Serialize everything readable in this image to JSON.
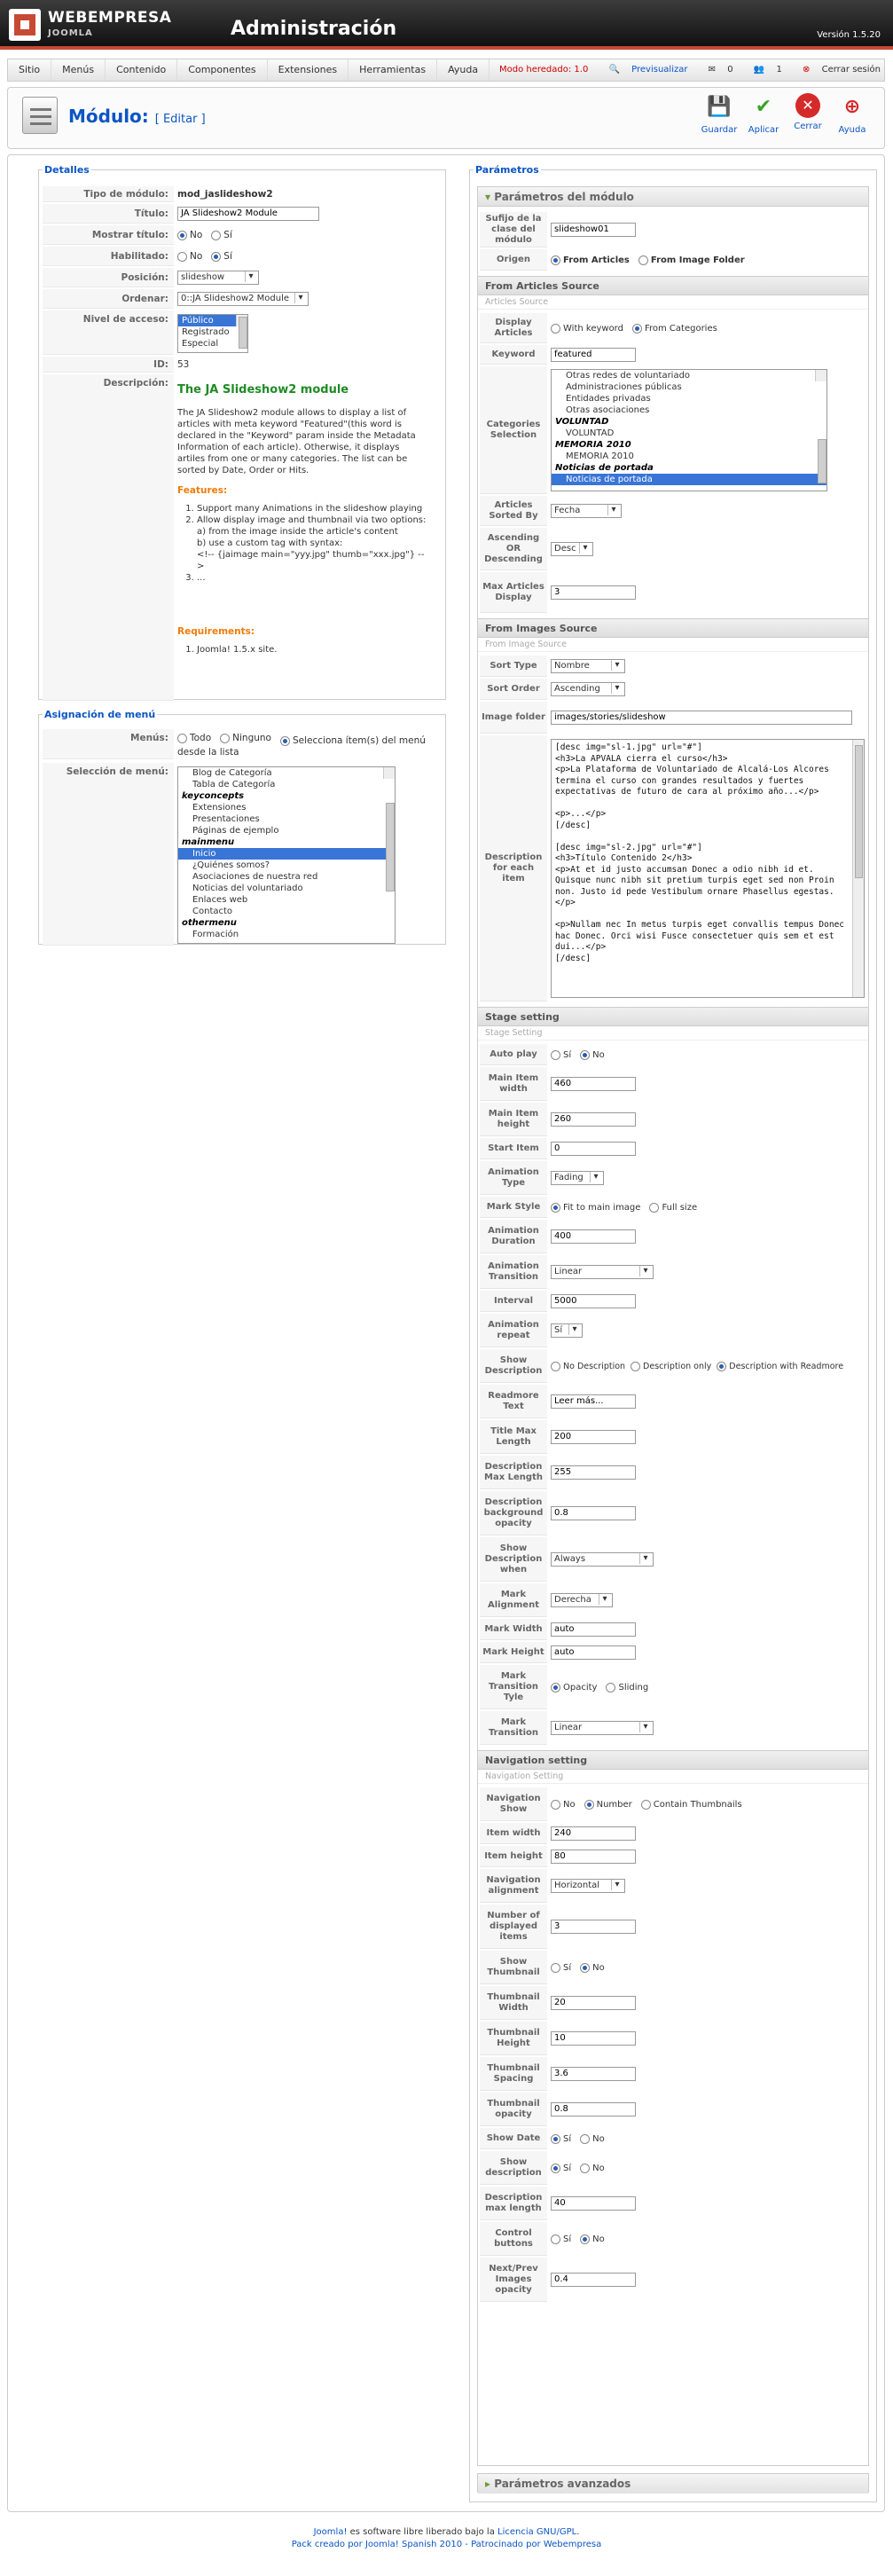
{
  "brand": {
    "line1": "WEBEMPRESA",
    "line2": "JOOMLA",
    "app_title": "Administración",
    "version": "Versión 1.5.20"
  },
  "menu": {
    "items": [
      "Sitio",
      "Menús",
      "Contenido",
      "Componentes",
      "Extensiones",
      "Herramientas",
      "Ayuda"
    ],
    "legacy": "Modo heredado: 1.0",
    "preview": "Previsualizar",
    "msg_count": "0",
    "user_count": "1",
    "logout": "Cerrar sesión"
  },
  "toolbar": {
    "title": "Módulo:",
    "edit": "[ Editar ]",
    "save": "Guardar",
    "apply": "Aplicar",
    "close": "Cerrar",
    "help": "Ayuda"
  },
  "details": {
    "legend": "Detalles",
    "type_label": "Tipo de módulo:",
    "type_value": "mod_jaslideshow2",
    "title_label": "Título:",
    "title_value": "JA Slideshow2 Module",
    "show_title_label": "Mostrar título:",
    "no": "No",
    "yes": "Sí",
    "enabled_label": "Habilitado:",
    "position_label": "Posición:",
    "position_value": "slideshow",
    "order_label": "Ordenar:",
    "order_value": "0::JA Slideshow2 Module",
    "access_label": "Nivel de acceso:",
    "access_options": [
      "Público",
      "Registrado",
      "Especial"
    ],
    "id_label": "ID:",
    "id_value": "53",
    "desc_label": "Descripción:",
    "desc_title": "The JA Slideshow2 module",
    "desc_p1": "The JA Slideshow2 module allows to display a list of articles with meta keyword \"Featured\"(this word is declared in the \"Keyword\" param inside the Metadata Information of each article). Otherwise, it displays artiles from one or many categories. The list can be sorted by Date, Order or Hits.",
    "features_title": "Features:",
    "feature1": "Support many Animations in the slideshow playing",
    "feature2a": "Allow display image and thumbnail via two options:",
    "feature2b": "a) from the image inside the article's content",
    "feature2c": "b) use a custom tag with syntax:",
    "feature2d": "<!-- {jaimage main=\"yyy.jpg\" thumb=\"xxx.jpg\"} -->",
    "feature3": "...",
    "req_title": "Requirements:",
    "req1": "Joomla! 1.5.x site."
  },
  "assign": {
    "legend": "Asignación de menú",
    "menus_label": "Menús:",
    "all": "Todo",
    "none": "Ninguno",
    "select": "Selecciona ítem(s) del menú desde la lista",
    "selection_label": "Selección de menú:",
    "items": [
      {
        "t": "Blog de Categoría",
        "k": "ind"
      },
      {
        "t": "Tabla de Categoría",
        "k": "ind"
      },
      {
        "t": "keyconcepts",
        "k": "grp"
      },
      {
        "t": "Extensiones",
        "k": "ind"
      },
      {
        "t": "Presentaciones",
        "k": "ind"
      },
      {
        "t": "Páginas de ejemplo",
        "k": "ind"
      },
      {
        "t": "mainmenu",
        "k": "grp"
      },
      {
        "t": "Inicio",
        "k": "sel"
      },
      {
        "t": "¿Quiénes somos?",
        "k": "ind"
      },
      {
        "t": "Asociaciones de nuestra red",
        "k": "ind"
      },
      {
        "t": "Noticias del voluntariado",
        "k": "ind"
      },
      {
        "t": "Enlaces web",
        "k": "ind"
      },
      {
        "t": "Contacto",
        "k": "ind"
      },
      {
        "t": "othermenu",
        "k": "grp"
      },
      {
        "t": "Formación",
        "k": "ind"
      }
    ]
  },
  "params": {
    "legend": "Parámetros",
    "box_title": "Parámetros del módulo",
    "suffix_label": "Sufijo de la clase del módulo",
    "suffix_value": "slideshow01",
    "origin_label": "Origen",
    "from_articles": "From Articles",
    "from_folder": "From Image Folder",
    "articles_head": "From Articles Source",
    "articles_sub": "Articles Source",
    "display_label": "Display Articles",
    "with_keyword": "With keyword",
    "from_categories": "From Categories",
    "keyword_label": "Keyword",
    "keyword_value": "featured",
    "cat_label": "Categories Selection",
    "cat_items": [
      {
        "t": "Otras redes de voluntariado",
        "k": "ind"
      },
      {
        "t": "Administraciones públicas",
        "k": "ind"
      },
      {
        "t": "Entidades privadas",
        "k": "ind"
      },
      {
        "t": "Otras asociaciones",
        "k": "ind"
      },
      {
        "t": "VOLUNTAD",
        "k": "grp"
      },
      {
        "t": "VOLUNTAD",
        "k": "ind"
      },
      {
        "t": "MEMORIA 2010",
        "k": "grp"
      },
      {
        "t": "MEMORIA 2010",
        "k": "ind"
      },
      {
        "t": "Noticias de portada",
        "k": "grp"
      },
      {
        "t": "Noticias de portada",
        "k": "sel"
      }
    ],
    "sorted_label": "Articles Sorted By",
    "sorted_value": "Fecha",
    "asc_label": "Ascending OR Descending",
    "asc_value": "Desc",
    "max_label": "Max Articles Display",
    "max_value": "3",
    "images_head": "From Images Source",
    "images_sub": "From Image Source",
    "sorttype_label": "Sort Type",
    "sorttype_value": "Nombre",
    "sortorder_label": "Sort Order",
    "sortorder_value": "Ascending",
    "folder_label": "Image folder",
    "folder_value": "images/stories/slideshow",
    "descitem_label": "Description for each item",
    "descitem_value": "[desc img=\"sl-1.jpg\" url=\"#\"]\n<h3>La APVALA cierra el curso</h3>\n<p>La Plataforma de Voluntariado de Alcalá-Los Alcores termina el curso con grandes resultados y fuertes expectativas de futuro de cara al próximo año...</p>\n\n<p>...</p>\n[/desc]\n\n[desc img=\"sl-2.jpg\" url=\"#\"]\n<h3>Título Contenido 2</h3>\n<p>At et id justo accumsan Donec a odio nibh id et. Quisque nunc nibh sit pretium turpis eget sed non Proin non. Justo id pede Vestibulum ornare Phasellus egestas.</p>\n\n<p>Nullam nec In metus turpis eget convallis tempus Donec hac Donec. Orci wisi Fusce consectetuer quis sem et est dui...</p>\n[/desc]",
    "stage_head": "Stage setting",
    "stage_sub": "Stage Setting",
    "autoplay_label": "Auto play",
    "mainw_label": "Main Item width",
    "mainw_value": "460",
    "mainh_label": "Main Item height",
    "mainh_value": "260",
    "start_label": "Start Item",
    "start_value": "0",
    "animtype_label": "Animation Type",
    "animtype_value": "Fading",
    "markstyle_label": "Mark Style",
    "fit_main": "Fit to main image",
    "full_size": "Full size",
    "animdur_label": "Animation Duration",
    "animdur_value": "400",
    "animtrans_label": "Animation Transition",
    "animtrans_value": "Linear",
    "interval_label": "Interval",
    "interval_value": "5000",
    "animrep_label": "Animation repeat",
    "animrep_value": "Sí",
    "showdesc_label": "Show Description",
    "no_desc": "No Description",
    "desc_only": "Description only",
    "desc_readmore": "Description with Readmore",
    "readmore_label": "Readmore Text",
    "readmore_value": "Leer más...",
    "titlemax_label": "Title Max Length",
    "titlemax_value": "200",
    "descmax_label": "Description Max Length",
    "descmax_value": "255",
    "descbg_label": "Description background opacity",
    "descbg_value": "0.8",
    "showwhen_label": "Show Description when",
    "showwhen_value": "Always",
    "markalign_label": "Mark Alignment",
    "markalign_value": "Derecha",
    "markw_label": "Mark Width",
    "markw_value": "auto",
    "markh_label": "Mark Height",
    "markh_value": "auto",
    "marktt_label": "Mark Transition Tyle",
    "opacity": "Opacity",
    "sliding": "Sliding",
    "markt_label": "Mark Transition",
    "markt_value": "Linear",
    "nav_head": "Navigation setting",
    "nav_sub": "Navigation Setting",
    "navshow_label": "Navigation Show",
    "number": "Number",
    "contain_thumbs": "Contain Thumbnails",
    "itemw_label": "Item width",
    "itemw_value": "240",
    "itemh_label": "Item height",
    "itemh_value": "80",
    "navalign_label": "Navigation alignment",
    "navalign_value": "Horizontal",
    "numdisp_label": "Number of displayed items",
    "numdisp_value": "3",
    "showthumb_label": "Show Thumbnail",
    "thumbw_label": "Thumbnail Width",
    "thumbw_value": "20",
    "thumbh_label": "Thumbnail Height",
    "thumbh_value": "10",
    "thumbsp_label": "Thumbnail Spacing",
    "thumbsp_value": "3.6",
    "thumbop_label": "Thumbnail opacity",
    "thumbop_value": "0.8",
    "showdate_label": "Show Date",
    "showdescn_label": "Show description",
    "descml_label": "Description max length",
    "descml_value": "40",
    "ctrl_label": "Control buttons",
    "nextprev_label": "Next/Prev Images opacity",
    "nextprev_value": "0.4",
    "advanced": "Parámetros avanzados"
  },
  "footer": {
    "joomla": "Joomla!",
    "text1": " es software libre liberado bajo la ",
    "license": "Licencia GNU/GPL",
    "text2": ".",
    "pack": "Pack creado por Joomla! Spanish 2010 - Patrocinado por Webempresa"
  },
  "colors": {
    "accent": "#0b55c4",
    "brand_red": "#c64934"
  }
}
